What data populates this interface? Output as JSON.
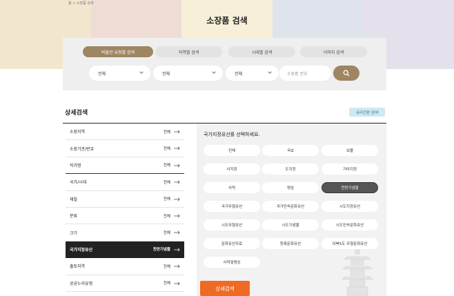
{
  "breadcrumb": "홈 > 소장품 검색",
  "page_title": "소장품 검색",
  "search_tabs": [
    {
      "label": "박물관 유형별 검색",
      "active": true
    },
    {
      "label": "지역별 검색",
      "active": false
    },
    {
      "label": "시대별 검색",
      "active": false
    },
    {
      "label": "이미지 검색",
      "active": false
    }
  ],
  "selects": [
    {
      "value": "전체"
    },
    {
      "value": "전체"
    },
    {
      "value": "전체"
    }
  ],
  "search": {
    "placeholder": "소장품 번호",
    "button_icon": "search-icon"
  },
  "detail": {
    "title": "상세검색",
    "glass_button": "유리건판 검색",
    "prompt": "국가지정유산를 선택하세요.",
    "submit": "상세검색"
  },
  "filters": [
    {
      "label": "소장지역",
      "value": "전체"
    },
    {
      "label": "소장기관/번호",
      "value": "전체"
    },
    {
      "label": "작가명",
      "value": "전체"
    },
    {
      "label": "국가/시대",
      "value": "전체"
    },
    {
      "label": "재질",
      "value": "전체"
    },
    {
      "label": "분류",
      "value": "전체"
    },
    {
      "label": "크기",
      "value": "전체"
    },
    {
      "label": "국가지정유산",
      "value": "천연기념물",
      "active": true
    },
    {
      "label": "출토지역",
      "value": "전체"
    },
    {
      "label": "공공누리유형",
      "value": "전체"
    }
  ],
  "options": [
    {
      "label": "전체"
    },
    {
      "label": "국보"
    },
    {
      "label": "보물"
    },
    {
      "label": "사지정"
    },
    {
      "label": "도지정"
    },
    {
      "label": "기타지정"
    },
    {
      "label": "사적"
    },
    {
      "label": "명승"
    },
    {
      "label": "천연기념물",
      "selected": true
    },
    {
      "label": "국가무형유산"
    },
    {
      "label": "국가민속문화유산"
    },
    {
      "label": "시도지정유산"
    },
    {
      "label": "시도무형유산"
    },
    {
      "label": "시도기념물"
    },
    {
      "label": "시도민속문화유산"
    },
    {
      "label": "문화유산자료"
    },
    {
      "label": "등록문화유산"
    },
    {
      "label": "이북5도 무형문화유산"
    },
    {
      "label": "사적및명승"
    }
  ],
  "colors": {
    "accent": "#9e8663",
    "submit": "#ef6a23",
    "selected": "#555555"
  }
}
